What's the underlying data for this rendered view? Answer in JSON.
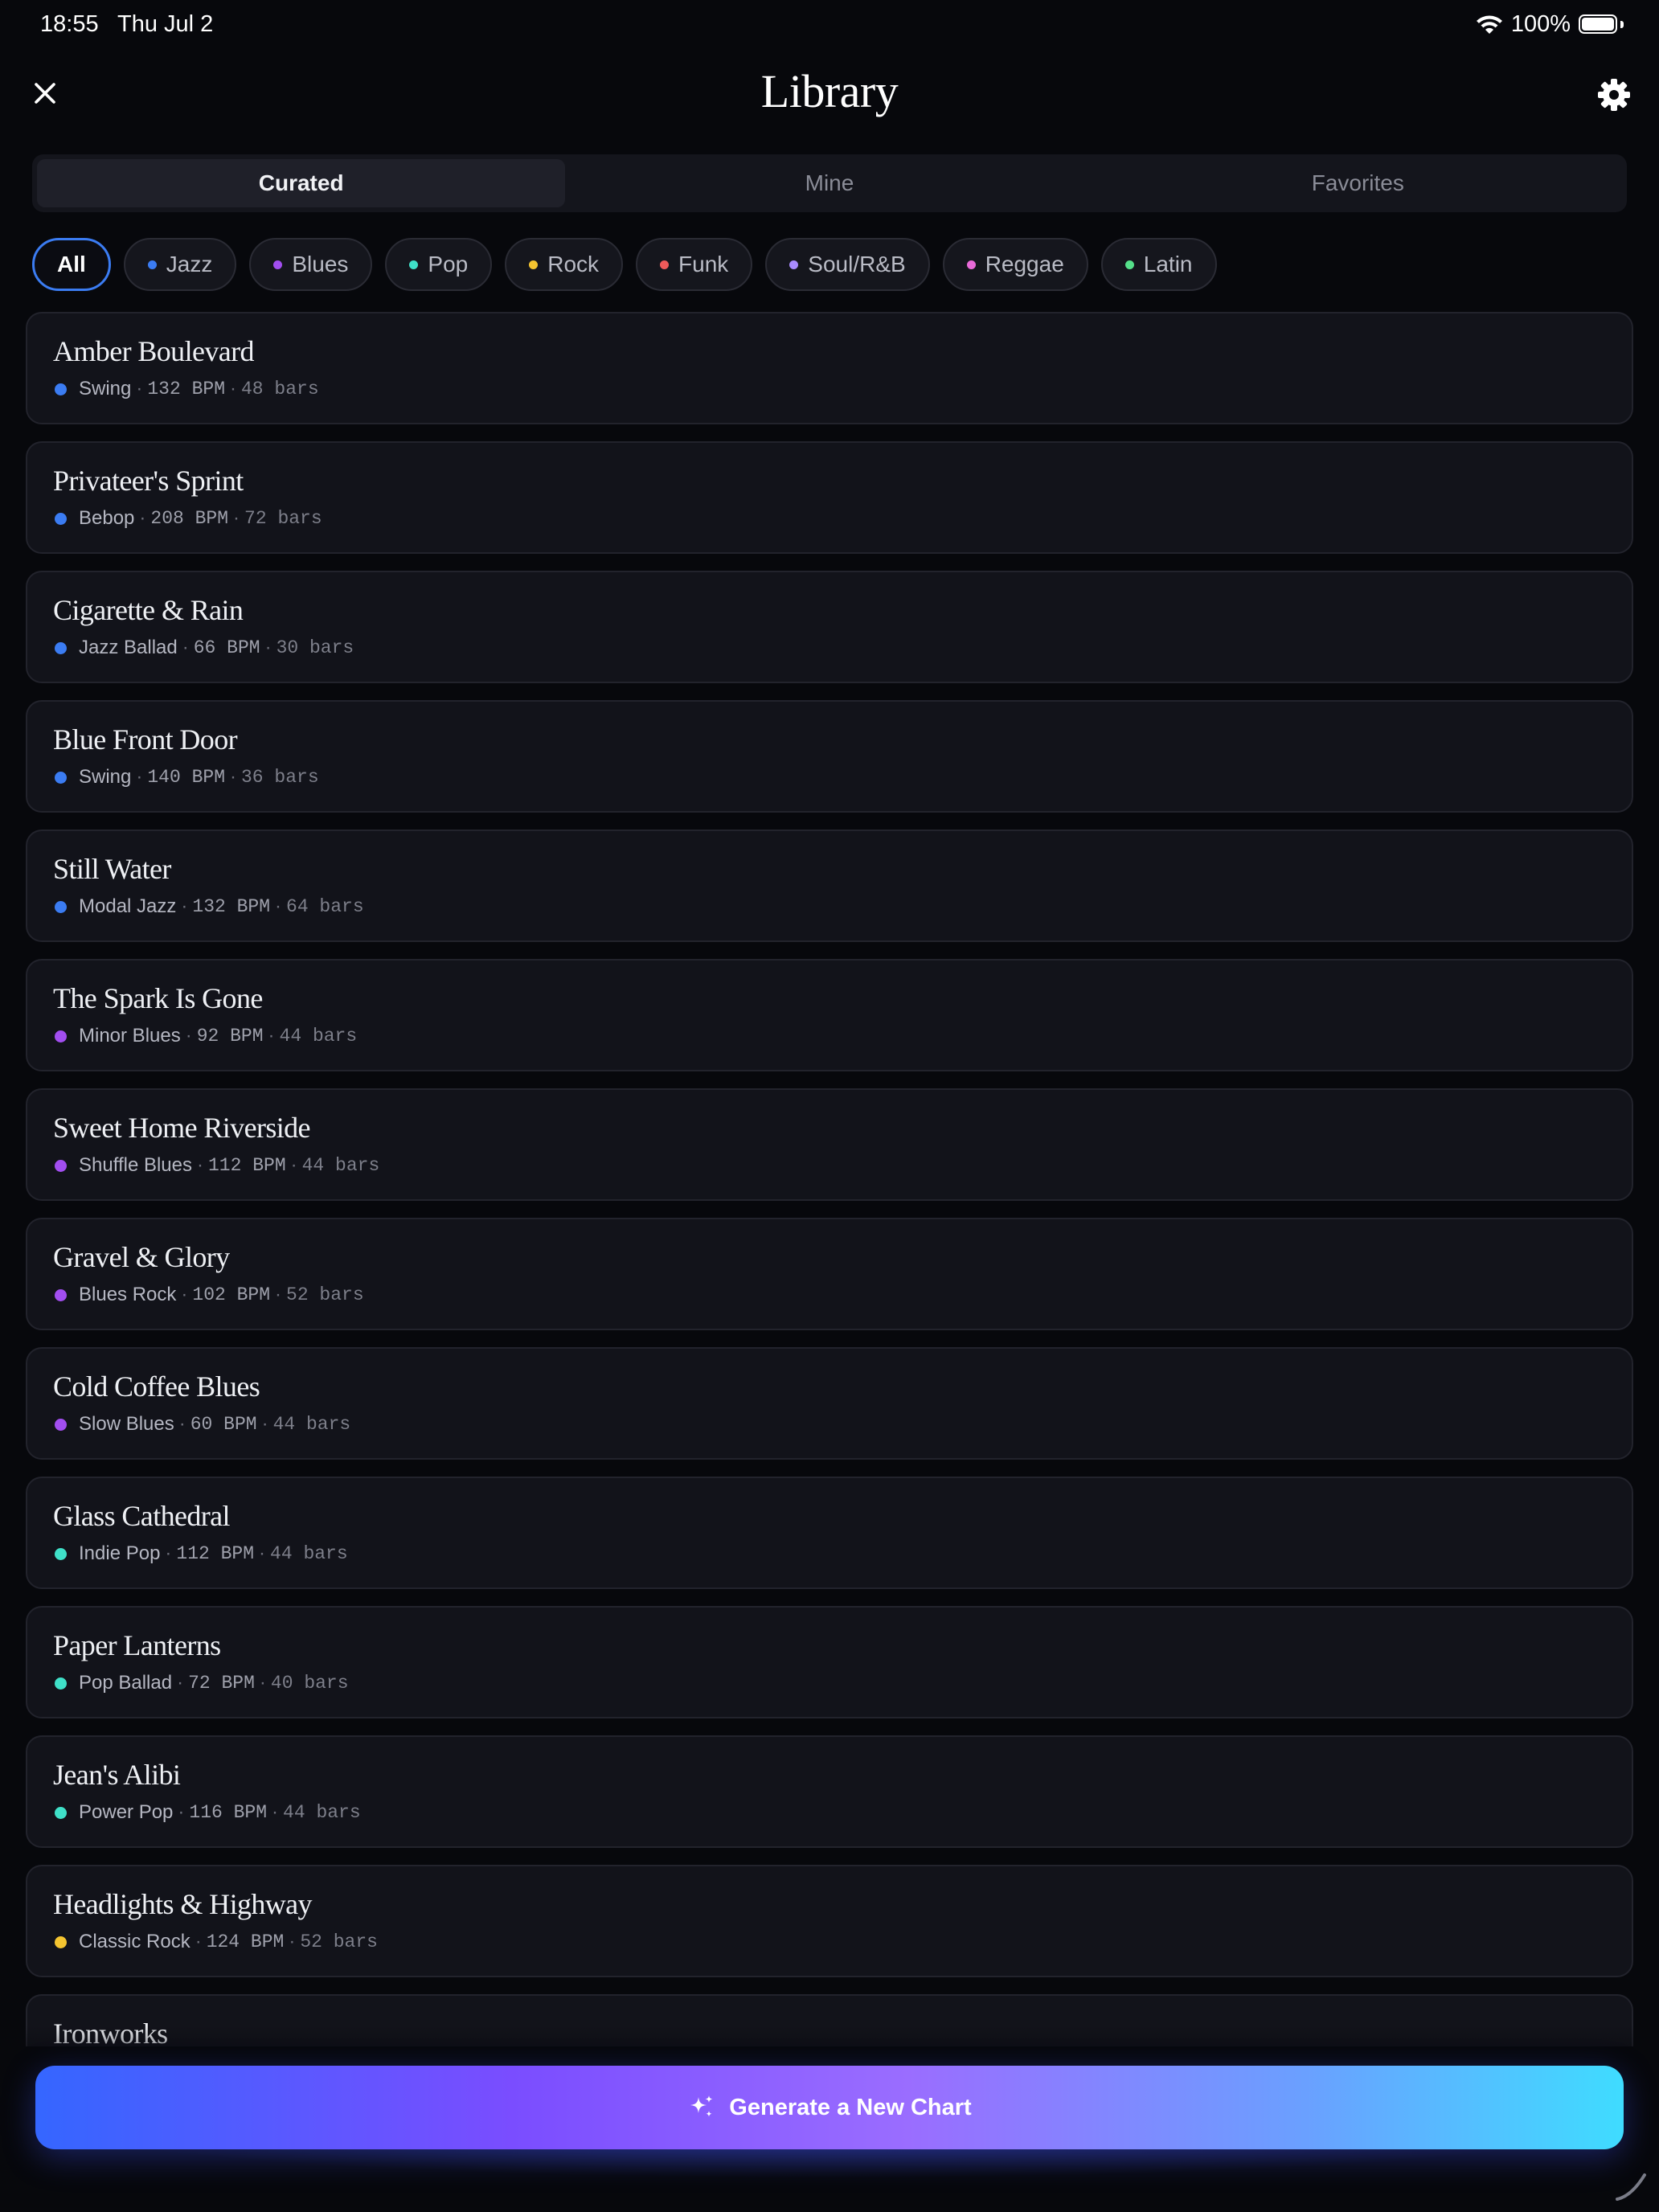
{
  "status_bar": {
    "time": "18:55",
    "date": "Thu Jul 2",
    "battery": "100%"
  },
  "header": {
    "title": "Library"
  },
  "tabs": [
    {
      "label": "Curated",
      "active": true
    },
    {
      "label": "Mine",
      "active": false
    },
    {
      "label": "Favorites",
      "active": false
    }
  ],
  "filters": [
    {
      "label": "All",
      "active": true,
      "color": ""
    },
    {
      "label": "Jazz",
      "color": "#3b7cf2"
    },
    {
      "label": "Blues",
      "color": "#a24ef0"
    },
    {
      "label": "Pop",
      "color": "#3fe0c8"
    },
    {
      "label": "Rock",
      "color": "#f4c430"
    },
    {
      "label": "Funk",
      "color": "#ef5a5a"
    },
    {
      "label": "Soul/R&B",
      "color": "#a98bff"
    },
    {
      "label": "Reggae",
      "color": "#e86ad8"
    },
    {
      "label": "Latin",
      "color": "#55e08a"
    }
  ],
  "songs": [
    {
      "title": "Amber Boulevard",
      "style": "Swing",
      "bpm": "132 BPM",
      "bars": "48 bars",
      "color": "#3b7cf2"
    },
    {
      "title": "Privateer's Sprint",
      "style": "Bebop",
      "bpm": "208 BPM",
      "bars": "72 bars",
      "color": "#3b7cf2"
    },
    {
      "title": "Cigarette & Rain",
      "style": "Jazz Ballad",
      "bpm": "66 BPM",
      "bars": "30 bars",
      "color": "#3b7cf2"
    },
    {
      "title": "Blue Front Door",
      "style": "Swing",
      "bpm": "140 BPM",
      "bars": "36 bars",
      "color": "#3b7cf2"
    },
    {
      "title": "Still Water",
      "style": "Modal Jazz",
      "bpm": "132 BPM",
      "bars": "64 bars",
      "color": "#3b7cf2"
    },
    {
      "title": "The Spark Is Gone",
      "style": "Minor Blues",
      "bpm": "92 BPM",
      "bars": "44 bars",
      "color": "#a24ef0"
    },
    {
      "title": "Sweet Home Riverside",
      "style": "Shuffle Blues",
      "bpm": "112 BPM",
      "bars": "44 bars",
      "color": "#a24ef0"
    },
    {
      "title": "Gravel & Glory",
      "style": "Blues Rock",
      "bpm": "102 BPM",
      "bars": "52 bars",
      "color": "#a24ef0"
    },
    {
      "title": "Cold Coffee Blues",
      "style": "Slow Blues",
      "bpm": "60 BPM",
      "bars": "44 bars",
      "color": "#a24ef0"
    },
    {
      "title": "Glass Cathedral",
      "style": "Indie Pop",
      "bpm": "112 BPM",
      "bars": "44 bars",
      "color": "#3fe0c8"
    },
    {
      "title": "Paper Lanterns",
      "style": "Pop Ballad",
      "bpm": "72 BPM",
      "bars": "40 bars",
      "color": "#3fe0c8"
    },
    {
      "title": "Jean's Alibi",
      "style": "Power Pop",
      "bpm": "116 BPM",
      "bars": "44 bars",
      "color": "#3fe0c8"
    },
    {
      "title": "Headlights & Highway",
      "style": "Classic Rock",
      "bpm": "124 BPM",
      "bars": "52 bars",
      "color": "#f4c430"
    },
    {
      "title": "Ironworks",
      "style": "",
      "bpm": "",
      "bars": "",
      "color": "#f4c430"
    }
  ],
  "generate_button": {
    "label": "Generate a New Chart",
    "icon": "sparkles-icon"
  },
  "icons": {
    "close": "close-icon",
    "settings": "gear-icon",
    "wifi": "wifi-icon",
    "battery": "battery-icon"
  }
}
